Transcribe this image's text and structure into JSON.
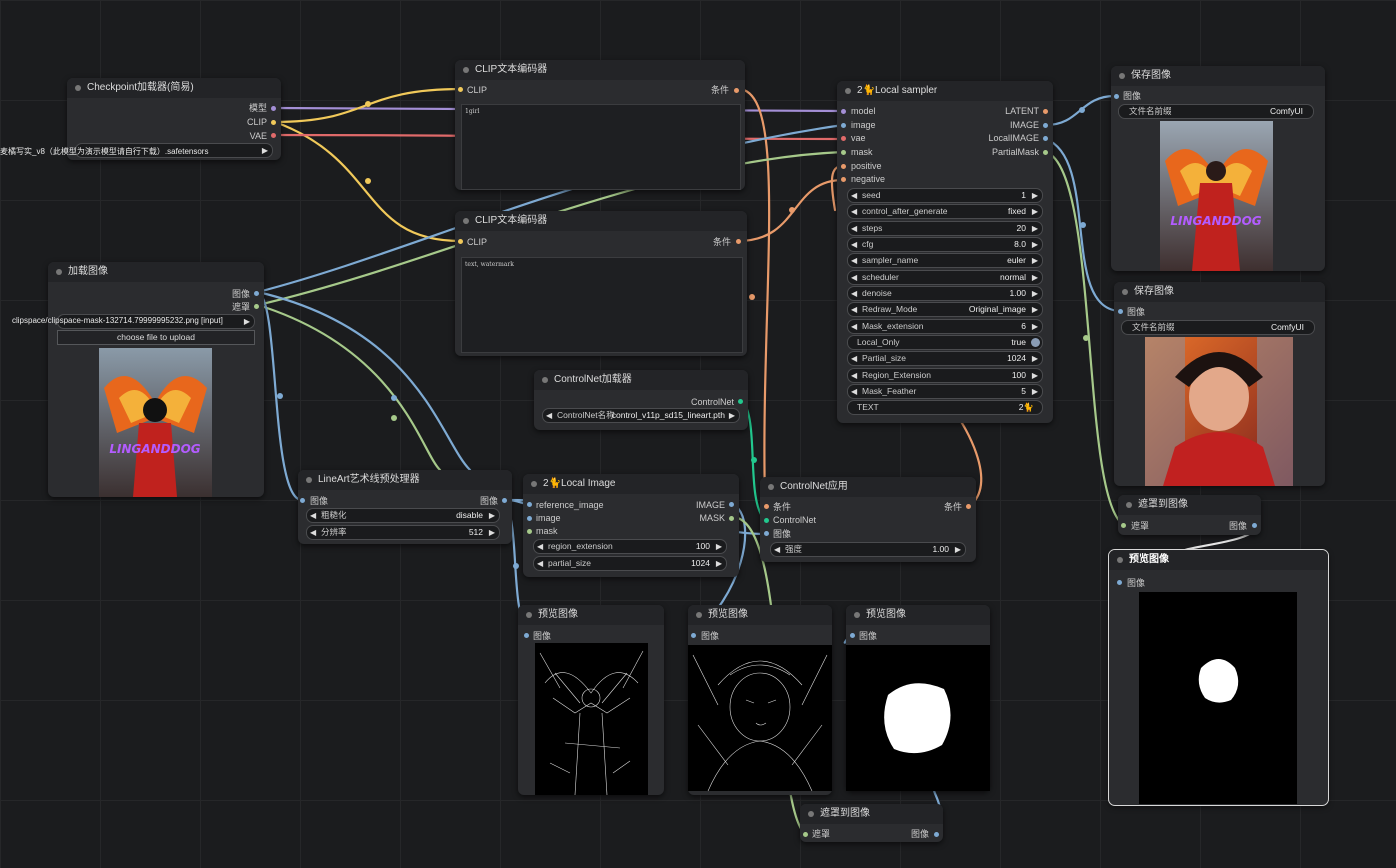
{
  "colors": {
    "clip": "#f1c95a",
    "model": "#a48fd6",
    "vae": "#e06a6a",
    "image": "#7eaad3",
    "mask": "#a6c98a",
    "cond": "#e89a6a",
    "controlnet": "#22c88e"
  },
  "ckpt": {
    "title": "Checkpoint加载器(简易)",
    "out_model": "模型",
    "out_clip": "CLIP",
    "out_vae": "VAE",
    "ckpt_value": "麦橘写实_v8（此模型为演示模型请自行下载）.safetensors"
  },
  "clip1": {
    "title": "CLIP文本编码器",
    "in_clip": "CLIP",
    "out": "条件",
    "text": "1girl"
  },
  "clip2": {
    "title": "CLIP文本编码器",
    "in_clip": "CLIP",
    "out": "条件",
    "text": "text, watermark"
  },
  "load": {
    "title": "加载图像",
    "out_image": "图像",
    "out_mask": "遮罩",
    "file": "clipspace/clipspace-mask-132714.79999995232.png [input]",
    "upload": "choose file to upload"
  },
  "lineart": {
    "title": "LineArt艺术线预处理器",
    "in_image": "图像",
    "out_image": "图像",
    "w1_label": "粗糙化",
    "w1_value": "disable",
    "w2_label": "分辨率",
    "w2_value": "512"
  },
  "cnload": {
    "title": "ControlNet加载器",
    "out": "ControlNet",
    "label": "ControlNet名称",
    "value": "control_v11p_sd15_lineart.pth"
  },
  "localimage": {
    "title": "2🐈Local Image",
    "in_ref": "reference_image",
    "in_image": "image",
    "in_mask": "mask",
    "out_image": "IMAGE",
    "out_mask": "MASK",
    "w1_label": "region_extension",
    "w1_value": "100",
    "w2_label": "partial_size",
    "w2_value": "1024"
  },
  "cnapply": {
    "title": "ControlNet应用",
    "in_cond": "条件",
    "in_cn": "ControlNet",
    "in_image": "图像",
    "out": "条件",
    "w_label": "强度",
    "w_value": "1.00"
  },
  "sampler": {
    "title": "2🐈Local sampler",
    "inputs": [
      "model",
      "image",
      "vae",
      "mask",
      "positive",
      "negative"
    ],
    "outputs": [
      "LATENT",
      "IMAGE",
      "LocalIMAGE",
      "PartialMask"
    ],
    "widgets": [
      {
        "label": "seed",
        "value": "1"
      },
      {
        "label": "control_after_generate",
        "value": "fixed"
      },
      {
        "label": "steps",
        "value": "20"
      },
      {
        "label": "cfg",
        "value": "8.0"
      },
      {
        "label": "sampler_name",
        "value": "euler"
      },
      {
        "label": "scheduler",
        "value": "normal"
      },
      {
        "label": "denoise",
        "value": "1.00"
      },
      {
        "label": "Redraw_Mode",
        "value": "Original_image"
      },
      {
        "label": "Mask_extension",
        "value": "6"
      },
      {
        "label": "Local_Only",
        "value": "true"
      },
      {
        "label": "Partial_size",
        "value": "1024"
      },
      {
        "label": "Region_Extension",
        "value": "100"
      },
      {
        "label": "Mask_Feather",
        "value": "5"
      },
      {
        "label": "TEXT",
        "value": "2🐈"
      }
    ]
  },
  "save1": {
    "title": "保存图像",
    "in": "图像",
    "prefix_label": "文件名前缀",
    "prefix_value": "ComfyUI"
  },
  "save2": {
    "title": "保存图像",
    "in": "图像",
    "prefix_label": "文件名前缀",
    "prefix_value": "ComfyUI"
  },
  "m2i1": {
    "title": "遮罩到图像",
    "in": "遮罩",
    "out": "图像"
  },
  "m2i2": {
    "title": "遮罩到图像",
    "in": "遮罩",
    "out": "图像"
  },
  "prev_big": {
    "title": "预览图像",
    "in": "图像"
  },
  "prev1": {
    "title": "预览图像",
    "in": "图像"
  },
  "prev2": {
    "title": "预览图像",
    "in": "图像"
  },
  "prev3": {
    "title": "预览图像",
    "in": "图像"
  },
  "watermark": "LINGANDDOG"
}
